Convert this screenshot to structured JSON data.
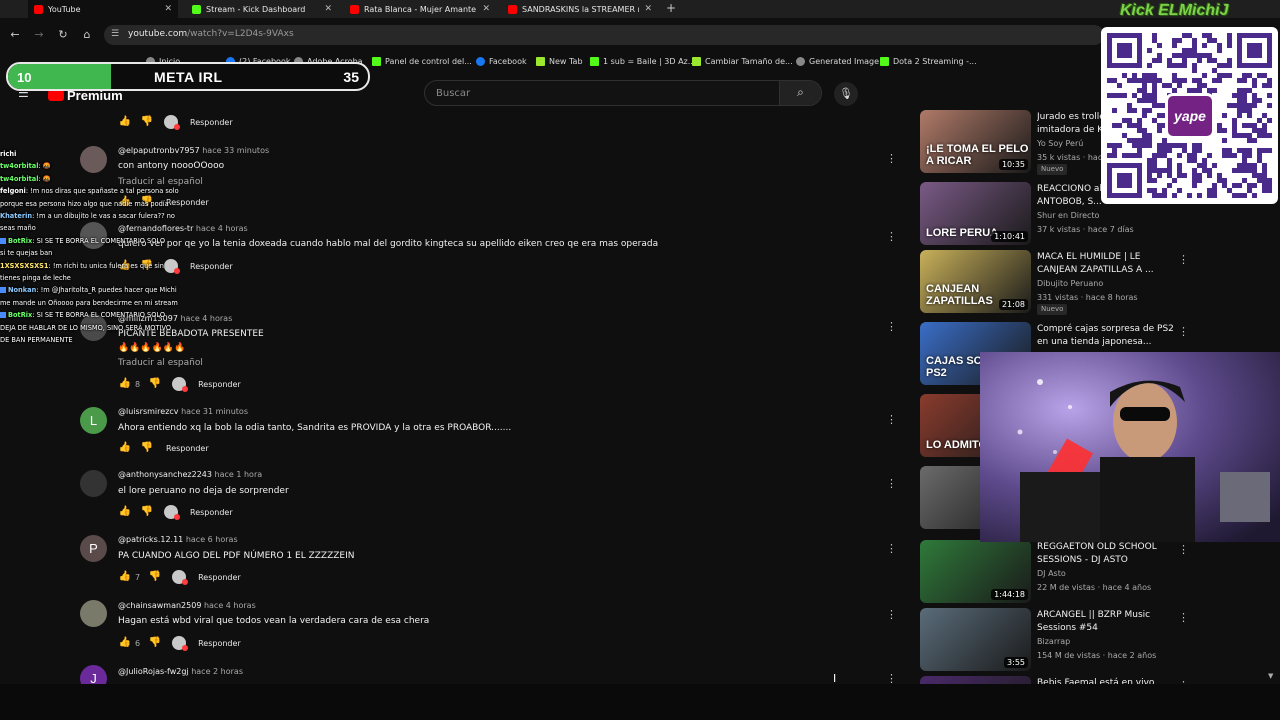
{
  "tabs": [
    {
      "title": "YouTube",
      "icon": "youtube-icon"
    },
    {
      "title": "Stream - Kick Dashboard",
      "icon": "kick-icon"
    },
    {
      "title": "Rata Blanca - Mujer Amante - Y",
      "icon": "youtube-icon"
    },
    {
      "title": "SANDRASKINS la STREAMER m",
      "icon": "youtube-icon"
    }
  ],
  "address": {
    "host": "youtube.com",
    "path": "/watch?v=L2D4s-9VAxs"
  },
  "bookmarks": [
    "Inicio",
    "(2) Facebook",
    "Adobe Acroba",
    "Panel de control del...",
    "Facebook",
    "New Tab",
    "1 sub = Baile | 3D Az...",
    "Cambiar Tamaño de...",
    "Generated Image",
    "Dota 2 Streaming -..."
  ],
  "goal": {
    "label": "META IRL",
    "current": "10",
    "target": "35",
    "progress": 0.2857
  },
  "youtube": {
    "logo": "Premium",
    "region": "PE",
    "search_placeholder": "Buscar"
  },
  "comments": [
    {
      "actions": {
        "likes": "",
        "reply": "Responder"
      }
    },
    {
      "author": "@elpaputronbv7957",
      "time": "hace 33 minutos",
      "text": "con antony noooOOooo",
      "translate": "Traducir al español",
      "actions": {
        "likes": "",
        "reply": "Responder"
      }
    },
    {
      "author": "@fernandoflores-tr",
      "time": "hace 4 horas",
      "text": "quiero ver por qe yo la tenia doxeada cuando hablo mal del gordito kingteca su apellido eiken creo qe era mas operada",
      "actions": {
        "likes": "",
        "reply": "Responder"
      }
    },
    {
      "author": "@millzm13097",
      "time": "hace 4 horas",
      "text": "PICANTE BEBADOTA PRESENTEE",
      "text2": "🔥🔥🔥🔥🔥🔥",
      "translate": "Traducir al español",
      "actions": {
        "likes": "8",
        "reply": "Responder"
      }
    },
    {
      "author": "@luisrsmirezcv",
      "time": "hace 31 minutos",
      "text": "Ahora entiendo xq la bob la odia tanto, Sandrita es PROVIDA y la otra es PROABOR.......",
      "avatar_letter": "L",
      "actions": {
        "likes": "",
        "reply": "Responder"
      }
    },
    {
      "author": "@anthonysanchez2243",
      "time": "hace 1 hora",
      "text": "el lore peruano no deja de sorprender",
      "actions": {
        "likes": "",
        "reply": "Responder"
      }
    },
    {
      "author": "@patricks.12.11",
      "time": "hace 6 horas",
      "text": "PA CUANDO ALGO DEL PDF NÚMERO 1 EL ZZZZZEIN",
      "avatar_letter": "P",
      "actions": {
        "likes": "7",
        "reply": "Responder"
      }
    },
    {
      "author": "@chainsawman2509",
      "time": "hace 4 horas",
      "text": "Hagan está wbd viral que todos vean la verdadera cara de esa chera",
      "actions": {
        "likes": "6",
        "reply": "Responder"
      }
    },
    {
      "author": "@JulioRojas-fw2gj",
      "time": "hace 2 horas",
      "avatar_letter": "J"
    }
  ],
  "chat": [
    {
      "user": "richi",
      "msg": "",
      "color": "white"
    },
    {
      "user": "tw4orbital",
      "msg": ": 🤬",
      "color": "green"
    },
    {
      "user": "tw4orbital",
      "msg": ": 🤬",
      "color": "green"
    },
    {
      "user": "felgoni",
      "msg": ": !m nos diras que spañaste a tal persona solo",
      "color": "white"
    },
    {
      "user": "",
      "msg": "porque esa persona hizo algo que nadie más podía",
      "color": "white"
    },
    {
      "user": "Khaterin",
      "msg": ": !m a un dibujito le vas a sacar fulera?? no",
      "color": "blue"
    },
    {
      "user": "",
      "msg": "seas maño",
      "color": "white"
    },
    {
      "user": "BotRix",
      "msg": ": SI SE TE BORRA EL COMENTARIO SOLO",
      "color": "green",
      "badge": true
    },
    {
      "user": "",
      "msg": "si te quejas ban",
      "color": "white"
    },
    {
      "user": "1XSXSXSXS1",
      "msg": ": !m richi tu unica fulera es que sin",
      "color": "yellow"
    },
    {
      "user": "",
      "msg": "tienes pinga de leche",
      "color": "white"
    },
    {
      "user": "Nonkan",
      "msg": ": !m @Jharitolta_R puedes hacer que Michi",
      "color": "blue",
      "badge": true
    },
    {
      "user": "",
      "msg": "me mande un Oñoooo para bendecirme en mi stream",
      "color": "white"
    },
    {
      "user": "BotRix",
      "msg": ": SI SE TE BORRA EL COMENTARIO SOLO",
      "color": "green",
      "badge": true
    },
    {
      "user": "",
      "msg": "DEJA DE HABLAR DE LO MISMO, SINO SERÁ MOTIVO",
      "color": "white"
    },
    {
      "user": "",
      "msg": "DE BAN PERMANENTE",
      "color": "white"
    }
  ],
  "sidebar": [
    {
      "title": "Jurado es trolleado por imitadora de Ka...",
      "channel": "Yo Soy Perú",
      "meta": "35 k vistas · hace...",
      "badge": "Nuevo",
      "duration": "10:35",
      "thumb_caption": "¡LE TOMA EL PELO A RICAR",
      "thumb_color": "#b07a68"
    },
    {
      "title": "REACCIONO al lore de ANTOBOB, S...",
      "channel": "Shur en Directo",
      "meta": "37 k vistas · hace 7 días",
      "duration": "1:10:41",
      "thumb_caption": "LORE PERUA",
      "thumb_color": "#7a5a86"
    },
    {
      "title": "MACA EL HUMILDE | LE CANJEAN ZAPATILLAS A ...",
      "channel": "Dibujito Peruano",
      "meta": "331 vistas · hace 8 horas",
      "badge": "Nuevo",
      "duration": "21:08",
      "thumb_caption": "CANJEAN ZAPATILLAS",
      "thumb_color": "#c9b15a"
    },
    {
      "title": "Compré cajas sorpresa de PS2 en una tienda japonesa... ¿vali...",
      "channel": "",
      "meta": "",
      "duration": "",
      "thumb_caption": "CAJAS SORPRESA PS2",
      "thumb_color": "#3a6ec8"
    },
    {
      "title": "",
      "channel": "",
      "meta": "",
      "duration": "",
      "thumb_caption": "LO ADMITO, PE",
      "thumb_color": "#8a3b2d"
    },
    {
      "title": "",
      "channel": "",
      "meta": "",
      "duration": "",
      "thumb_caption": "",
      "thumb_color": "#6b6b6b"
    },
    {
      "title": "REGGAETON OLD SCHOOL SESSIONS - DJ ASTO",
      "channel": "DJ Asto",
      "meta": "22 M de vistas · hace 4 años",
      "duration": "1:44:18",
      "thumb_caption": "",
      "thumb_color": "#2f7a3a"
    },
    {
      "title": "ARCANGEL || BZRP Music Sessions #54",
      "channel": "Bizarrap",
      "meta": "154 M de vistas · hace 2 años",
      "duration": "3:55",
      "thumb_caption": "",
      "thumb_color": "#5a6c7a"
    },
    {
      "title": "Bebis Faemal está en vivo en...",
      "channel": "",
      "meta": "",
      "duration": "",
      "thumb_caption": "",
      "thumb_color": "#4a2a6a"
    }
  ],
  "overlay": {
    "channel_label": "Kick ELMichiJ",
    "yape_label": "yape"
  }
}
